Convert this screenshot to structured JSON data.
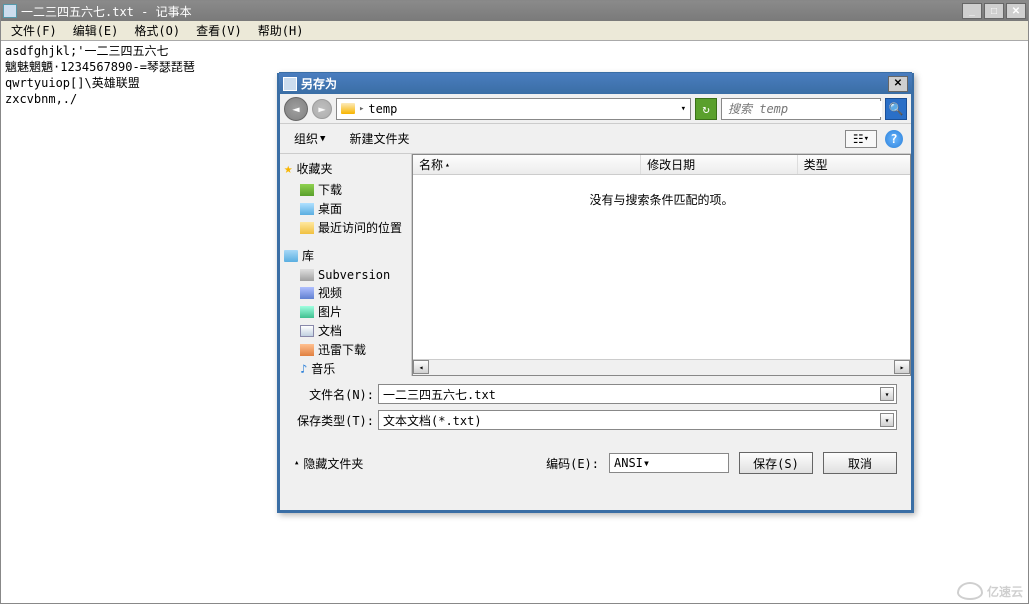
{
  "notepad": {
    "title": "一二三四五六七.txt - 记事本",
    "menu": {
      "file": "文件(F)",
      "edit": "编辑(E)",
      "format": "格式(O)",
      "view": "查看(V)",
      "help": "帮助(H)"
    },
    "content": "asdfghjkl;'一二三四五六七\n魑魅魍魉·1234567890-=琴瑟琵琶\nqwrtyuiop[]\\英雄联盟\nzxcvbnm,./"
  },
  "dialog": {
    "title": "另存为",
    "breadcrumb": {
      "folder": "temp"
    },
    "search_placeholder": "搜索 temp",
    "toolbar": {
      "organize": "组织",
      "new_folder": "新建文件夹"
    },
    "tree": {
      "favorites": "收藏夹",
      "favorites_items": [
        "下载",
        "桌面",
        "最近访问的位置"
      ],
      "libraries": "库",
      "libraries_items": [
        "Subversion",
        "视频",
        "图片",
        "文档",
        "迅雷下载",
        "音乐"
      ]
    },
    "columns": {
      "name": "名称",
      "date": "修改日期",
      "type": "类型"
    },
    "empty_message": "没有与搜索条件匹配的项。",
    "filename_label": "文件名(N):",
    "filename_value": "一二三四五六七.txt",
    "type_label": "保存类型(T):",
    "type_value": "文本文档(*.txt)",
    "hide_folders": "隐藏文件夹",
    "encoding_label": "编码(E):",
    "encoding_value": "ANSI",
    "save_btn": "保存(S)",
    "cancel_btn": "取消"
  },
  "watermark": "亿速云"
}
